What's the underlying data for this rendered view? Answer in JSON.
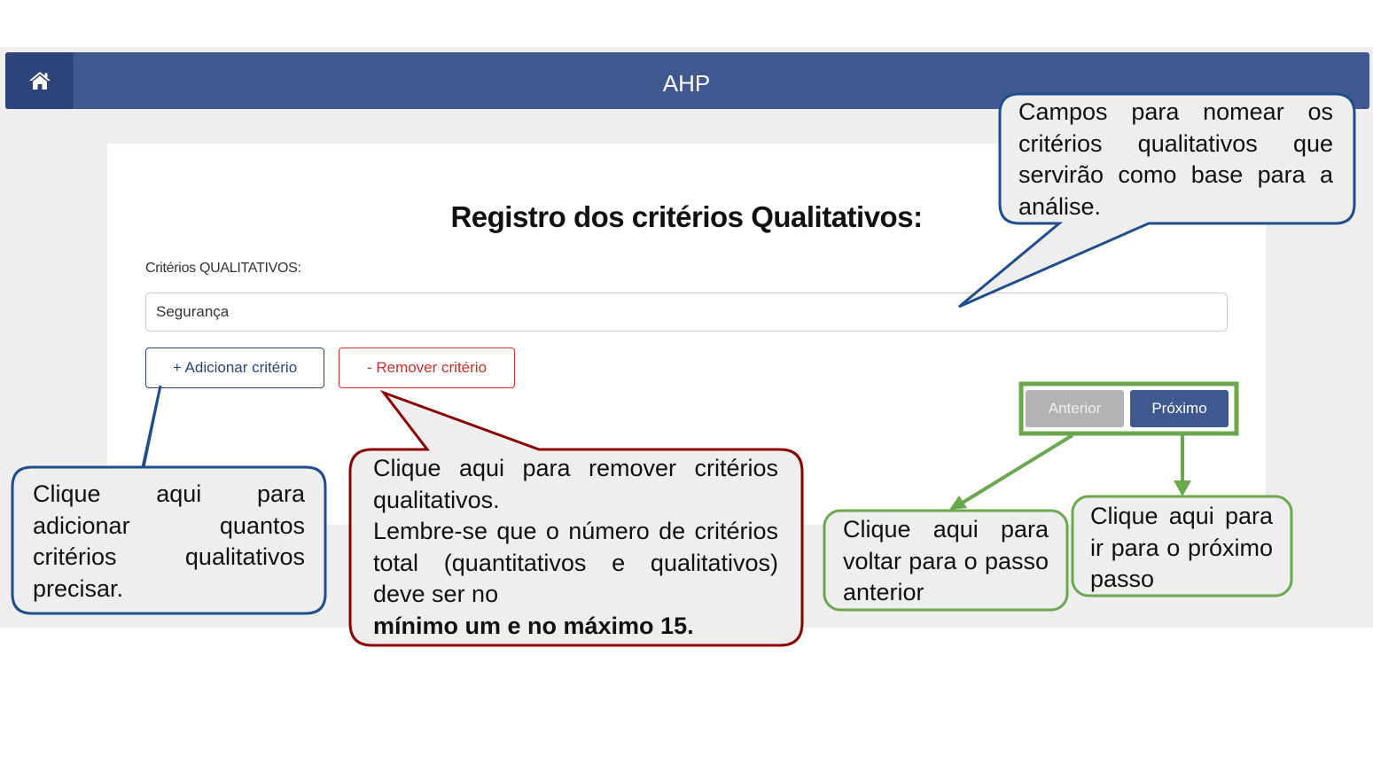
{
  "header": {
    "title": "AHP",
    "home_icon": "home-icon"
  },
  "form": {
    "title": "Registro dos critérios Qualitativos:",
    "field_label": "Critérios QUALITATIVOS:",
    "criteria_value": "Segurança",
    "add_label": "+ Adicionar critério",
    "remove_label": "- Remover critério"
  },
  "nav_buttons": {
    "prev_label": "Anterior",
    "next_label": "Próximo"
  },
  "callouts": {
    "fields": "Campos para nomear os critérios qualitativos que servirão como base para a análise.",
    "add": "Clique aqui para adicionar quantos critérios qualitativos precisar.",
    "remove_line1": "Clique aqui para remover critérios qualitativos.",
    "remove_line2": "Lembre-se que o número de critérios total (quantitativos e qualitativos) deve ser no",
    "remove_bold": "mínimo um e no máximo 15.",
    "prev": "Clique aqui para voltar para o passo anterior",
    "next": "Clique aqui para ir para o próximo passo"
  },
  "colors": {
    "navbar": "#3f5890",
    "home_button": "#2c4478",
    "remove": "#c9302c",
    "callout_blue": "#1f4e8c",
    "callout_red": "#8b0000",
    "callout_green": "#6aa84f"
  }
}
